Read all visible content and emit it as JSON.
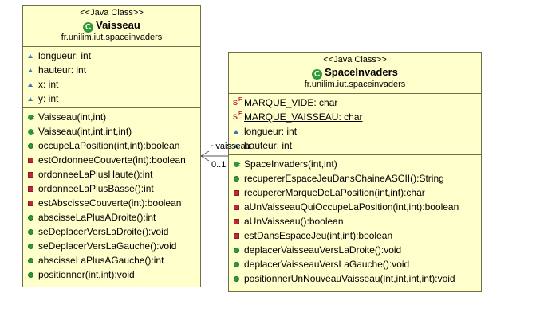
{
  "classes": {
    "vaisseau": {
      "stereotype": "<<Java Class>>",
      "name": "Vaisseau",
      "package": "fr.unilim.iut.spaceinvaders",
      "attributes": [
        "longueur: int",
        "hauteur: int",
        "x: int",
        "y: int"
      ],
      "constructors": [
        "Vaisseau(int,int)",
        "Vaisseau(int,int,int,int)"
      ],
      "methods": [
        {
          "text": "occupeLaPosition(int,int):boolean",
          "visibility": "public"
        },
        {
          "text": "estOrdonneeCouverte(int):boolean",
          "visibility": "private"
        },
        {
          "text": "ordonneeLaPlusHaute():int",
          "visibility": "private"
        },
        {
          "text": "ordonneeLaPlusBasse():int",
          "visibility": "private"
        },
        {
          "text": "estAbscisseCouverte(int):boolean",
          "visibility": "private"
        },
        {
          "text": "abscisseLaPlusADroite():int",
          "visibility": "public"
        },
        {
          "text": "seDeplacerVersLaDroite():void",
          "visibility": "public"
        },
        {
          "text": "seDeplacerVersLaGauche():void",
          "visibility": "public"
        },
        {
          "text": "abscisseLaPlusAGauche():int",
          "visibility": "public"
        },
        {
          "text": "positionner(int,int):void",
          "visibility": "public"
        }
      ]
    },
    "spaceinvaders": {
      "stereotype": "<<Java Class>>",
      "name": "SpaceInvaders",
      "package": "fr.unilim.iut.spaceinvaders",
      "static_fields": [
        "MARQUE_VIDE: char",
        "MARQUE_VAISSEAU: char"
      ],
      "attributes": [
        "longueur: int",
        "hauteur: int"
      ],
      "constructors": [
        "SpaceInvaders(int,int)"
      ],
      "methods": [
        {
          "text": "recupererEspaceJeuDansChaineASCII():String",
          "visibility": "public"
        },
        {
          "text": "recupererMarqueDeLaPosition(int,int):char",
          "visibility": "private"
        },
        {
          "text": "aUnVaisseauQuiOccupeLaPosition(int,int):boolean",
          "visibility": "private"
        },
        {
          "text": "aUnVaisseau():boolean",
          "visibility": "private"
        },
        {
          "text": "estDansEspaceJeu(int,int):boolean",
          "visibility": "private"
        },
        {
          "text": "deplacerVaisseauVersLaDroite():void",
          "visibility": "public"
        },
        {
          "text": "deplacerVaisseauVersLaGauche():void",
          "visibility": "public"
        },
        {
          "text": "positionnerUnNouveauVaisseau(int,int,int,int):void",
          "visibility": "public"
        }
      ]
    }
  },
  "association": {
    "role": "~vaisseau",
    "multiplicity": "0..1"
  }
}
